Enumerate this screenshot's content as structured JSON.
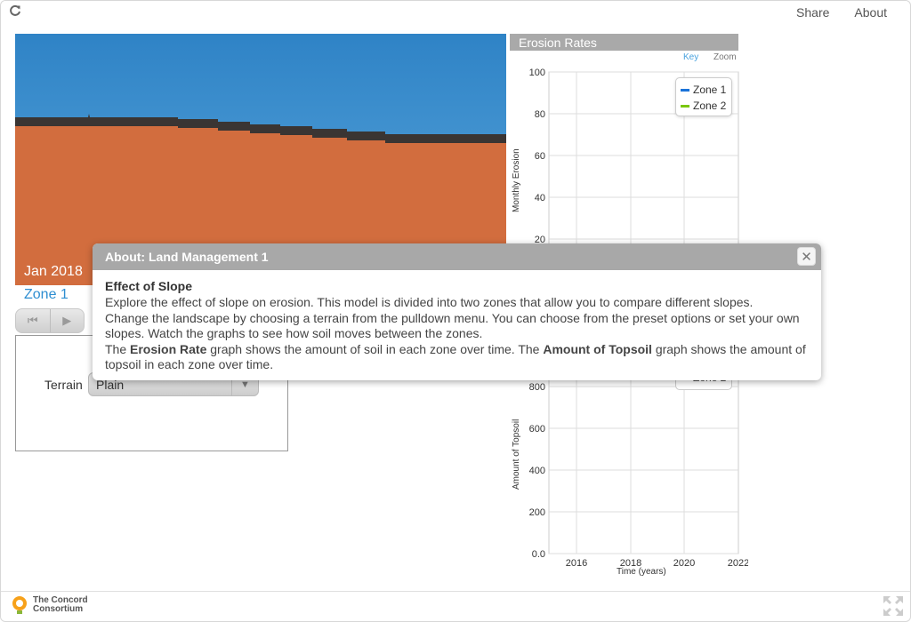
{
  "topbar": {
    "share_label": "Share",
    "about_label": "About"
  },
  "scene": {
    "date": "Jan 2018",
    "zone": "Zone 1",
    "sky_color": "#3b8fcf",
    "soil_color": "#d26d3e",
    "topsoil_color": "#3a3533"
  },
  "controls": {
    "terrain_label": "Terrain",
    "terrain_value": "Plain"
  },
  "chart_data": [
    {
      "type": "line",
      "title": "Erosion Rates",
      "ylabel": "Monthly Erosion",
      "yticks": [
        "100",
        "80",
        "60",
        "40",
        "20"
      ],
      "links": {
        "key": "Key",
        "zoom": "Zoom"
      },
      "series": [
        {
          "name": "Zone 1",
          "color": "#1a73d9",
          "values": []
        },
        {
          "name": "Zone 2",
          "color": "#7ac70c",
          "values": []
        }
      ]
    },
    {
      "type": "line",
      "xlabel": "Time (years)",
      "ylabel": "Amount of Topsoil",
      "yticks": [
        "800",
        "600",
        "400",
        "200",
        "0.0"
      ],
      "xticks": [
        "2016",
        "2018",
        "2020",
        "2022"
      ],
      "legend_visible": "Zone 2",
      "series": []
    }
  ],
  "dialog": {
    "title": "About: Land Management 1",
    "heading": "Effect of Slope",
    "p1": "Explore the effect of slope on erosion. This model is divided into two zones that allow you to compare different slopes.",
    "p2": "Change the landscape by choosing a terrain from the pulldown menu. You can choose from the preset options or set your own slopes. Watch the graphs to see how soil moves between the zones.",
    "p3_a": "The ",
    "p3_b": "Erosion Rate",
    "p3_c": " graph shows the amount of soil in each zone over time. The ",
    "p3_d": "Amount of Topsoil",
    "p3_e": " graph shows the amount of topsoil in each zone over time."
  },
  "footer": {
    "logo_line1": "The Concord",
    "logo_line2": "Consortium"
  }
}
